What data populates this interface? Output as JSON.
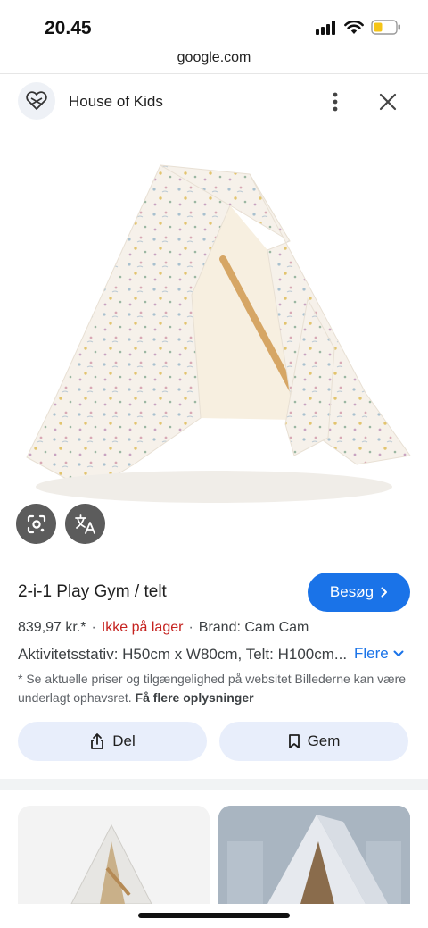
{
  "status_bar": {
    "time": "20.45"
  },
  "browser": {
    "url": "google.com"
  },
  "site": {
    "name": "House of Kids"
  },
  "product": {
    "title": "2-i-1 Play Gym / telt",
    "visit_label": "Besøg",
    "price": "839,97 kr.*",
    "stock": "Ikke på lager",
    "brand": "Brand: Cam Cam",
    "description": "Aktivitetsstativ: H50cm x W80cm, Telt: H100cm...",
    "more_label": "Flere",
    "disclaimer_text": "* Se aktuelle priser og tilgængelighed på websitet Billederne kan være underlagt ophavsret.",
    "disclaimer_link": "Få flere oplysninger"
  },
  "actions": {
    "share_label": "Del",
    "save_label": "Gem"
  },
  "icons": {
    "lens": "google-lens-icon",
    "translate": "translate-icon",
    "more": "more-vert-icon",
    "close": "close-icon",
    "share": "share-icon",
    "bookmark": "bookmark-icon"
  },
  "colors": {
    "accent": "#1a73e8",
    "out_of_stock": "#c5221f",
    "action_button_bg": "#e8eefb"
  }
}
